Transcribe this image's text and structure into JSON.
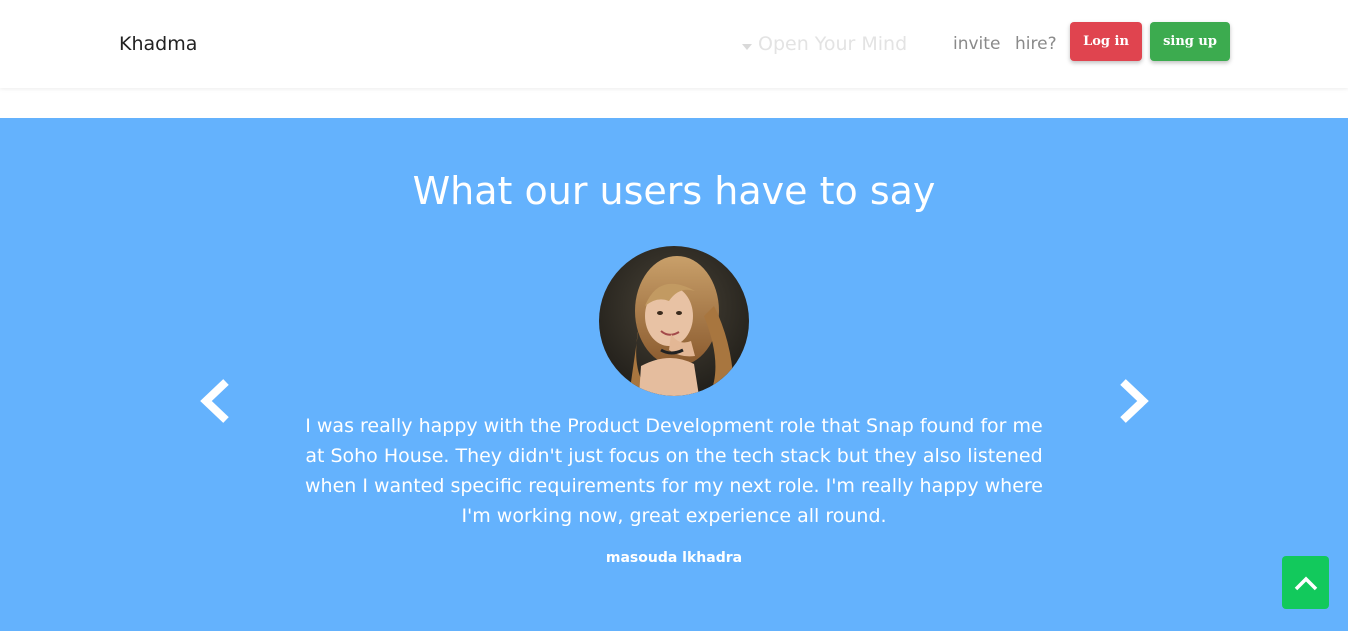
{
  "navbar": {
    "brand": "Khadma",
    "dropdown_label": "Open Your Mind",
    "links": {
      "invite": "invite",
      "hire": "hire?"
    },
    "buttons": {
      "login": "Log in",
      "signup": "sing up"
    }
  },
  "testimonials": {
    "title": "What our users have to say",
    "quote": "I was really happy with the Product Development role that Snap found for me at Soho House. They didn't just focus on the tech stack but they also listened when I wanted specific requirements for my next role. I'm really happy where I'm working now, great experience all round.",
    "author": "masouda lkhadra",
    "prev_icon": "chevron-left-icon",
    "next_icon": "chevron-right-icon"
  },
  "back_to_top_icon": "chevron-up-icon",
  "colors": {
    "section_bg": "#64b2fd",
    "login_btn": "#e0444f",
    "signup_btn": "#3cab4f",
    "back_to_top": "#12c95c"
  }
}
